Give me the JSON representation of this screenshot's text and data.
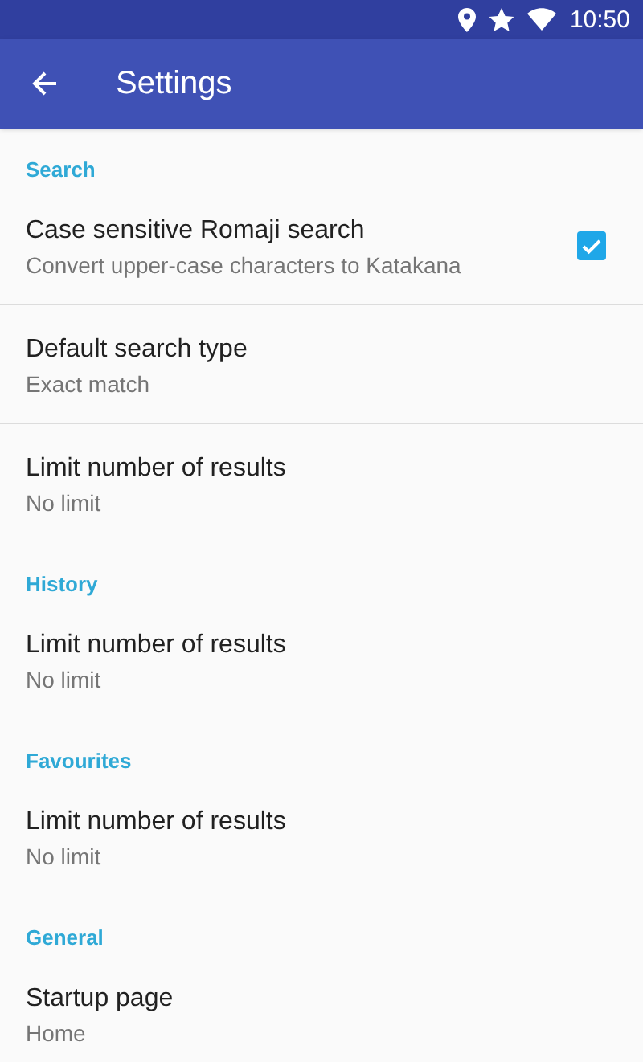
{
  "status_bar": {
    "time": "10:50"
  },
  "toolbar": {
    "title": "Settings"
  },
  "sections": [
    {
      "title": "Search",
      "items": [
        {
          "kind": "checkbox",
          "title": "Case sensitive Romaji search",
          "summary": "Convert upper-case characters to Katakana",
          "checked": true
        },
        {
          "kind": "plain",
          "title": "Default search type",
          "summary": "Exact match"
        },
        {
          "kind": "plain",
          "title": "Limit number of results",
          "summary": "No limit"
        }
      ]
    },
    {
      "title": "History",
      "items": [
        {
          "kind": "plain",
          "title": "Limit number of results",
          "summary": "No limit"
        }
      ]
    },
    {
      "title": "Favourites",
      "items": [
        {
          "kind": "plain",
          "title": "Limit number of results",
          "summary": "No limit"
        }
      ]
    },
    {
      "title": "General",
      "items": [
        {
          "kind": "plain",
          "title": "Startup page",
          "summary": "Home"
        }
      ]
    }
  ]
}
